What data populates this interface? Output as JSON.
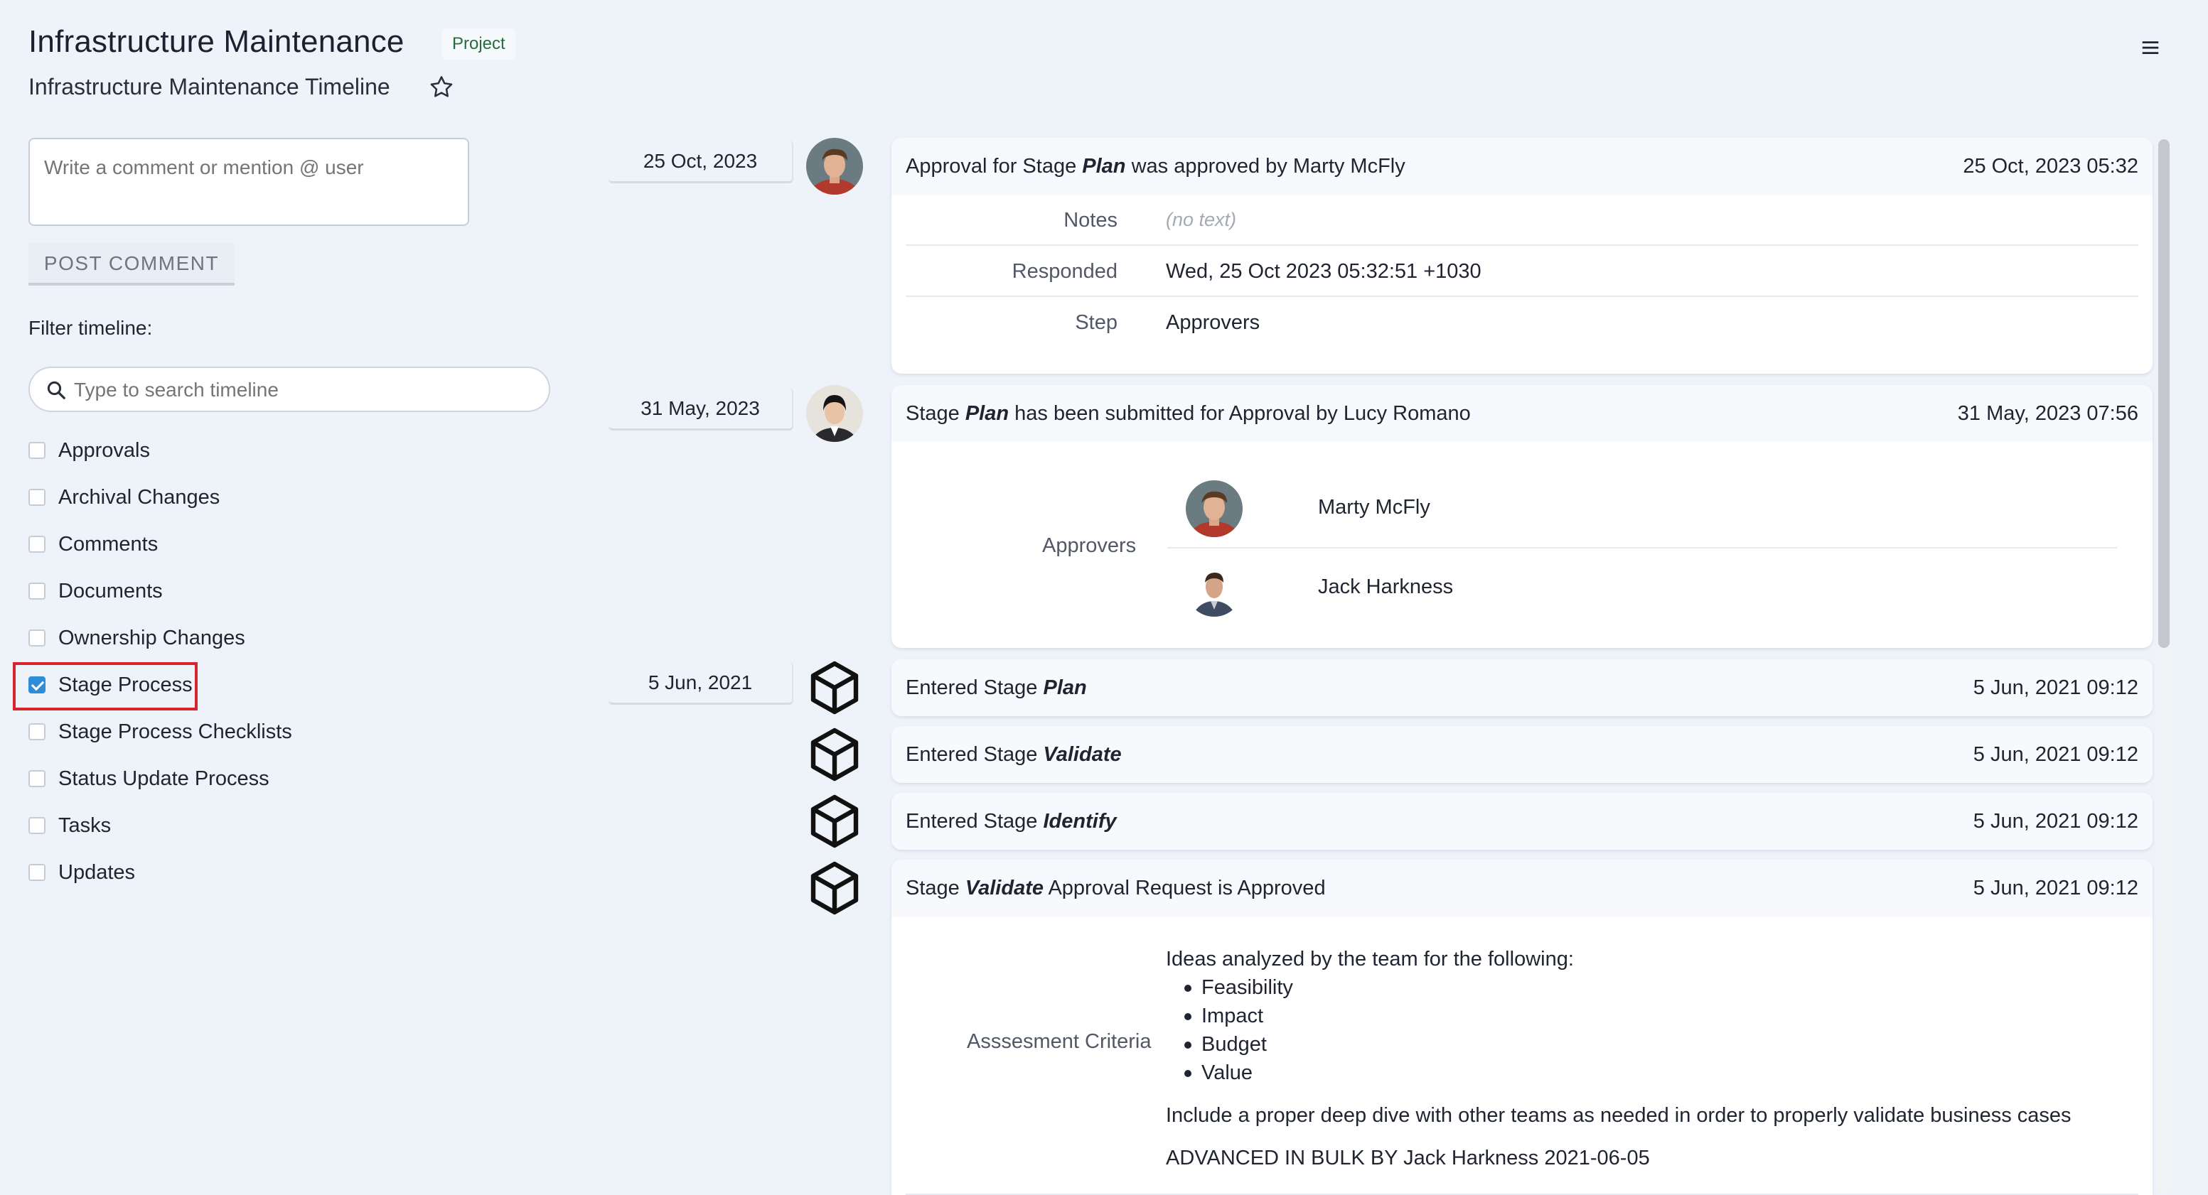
{
  "header": {
    "title": "Infrastructure Maintenance",
    "badge": "Project",
    "subtitle": "Infrastructure Maintenance Timeline"
  },
  "comment": {
    "placeholder": "Write a comment or mention @ user",
    "post_label": "POST COMMENT"
  },
  "filter": {
    "label": "Filter timeline:",
    "search_placeholder": "Type to search timeline",
    "options": [
      {
        "label": "Approvals",
        "checked": false
      },
      {
        "label": "Archival Changes",
        "checked": false
      },
      {
        "label": "Comments",
        "checked": false
      },
      {
        "label": "Documents",
        "checked": false
      },
      {
        "label": "Ownership Changes",
        "checked": false
      },
      {
        "label": "Stage Process",
        "checked": true
      },
      {
        "label": "Stage Process Checklists",
        "checked": false
      },
      {
        "label": "Status Update Process",
        "checked": false
      },
      {
        "label": "Tasks",
        "checked": false
      },
      {
        "label": "Updates",
        "checked": false
      }
    ]
  },
  "timeline": {
    "dates": [
      "25 Oct, 2023",
      "31 May, 2023",
      "5 Jun, 2021"
    ],
    "events": [
      {
        "pre": "Approval for Stage ",
        "em": "Plan",
        "post": " was approved by Marty McFly",
        "time": "25 Oct, 2023 05:32",
        "details": [
          {
            "key": "Notes",
            "value": "(no text)"
          },
          {
            "key": "Responded",
            "value": "Wed, 25 Oct 2023 05:32:51 +1030"
          },
          {
            "key": "Step",
            "value": "Approvers"
          }
        ]
      },
      {
        "pre": "Stage ",
        "em": "Plan",
        "post": " has been submitted for Approval by Lucy Romano",
        "time": "31 May, 2023 07:56",
        "approvers_label": "Approvers",
        "approvers": [
          "Marty McFly",
          "Jack Harkness"
        ]
      },
      {
        "pre": "Entered Stage ",
        "em": "Plan",
        "post": "",
        "time": "5 Jun, 2021 09:12"
      },
      {
        "pre": "Entered Stage ",
        "em": "Validate",
        "post": "",
        "time": "5 Jun, 2021 09:12"
      },
      {
        "pre": "Entered Stage ",
        "em": "Identify",
        "post": "",
        "time": "5 Jun, 2021 09:12"
      },
      {
        "pre": "Stage ",
        "em": "Validate",
        "post": " Approval Request is Approved",
        "time": "5 Jun, 2021 09:12",
        "criteria_label": "Asssesment Criteria",
        "criteria_intro": "Ideas analyzed by the team for the following:",
        "criteria_items": [
          "Feasibility",
          "Impact",
          "Budget",
          "Value"
        ],
        "criteria_note": "Include a proper deep dive with other teams as needed in order to properly validate business cases",
        "criteria_footer": "ADVANCED IN BULK BY Jack Harkness 2021-06-05"
      }
    ]
  }
}
